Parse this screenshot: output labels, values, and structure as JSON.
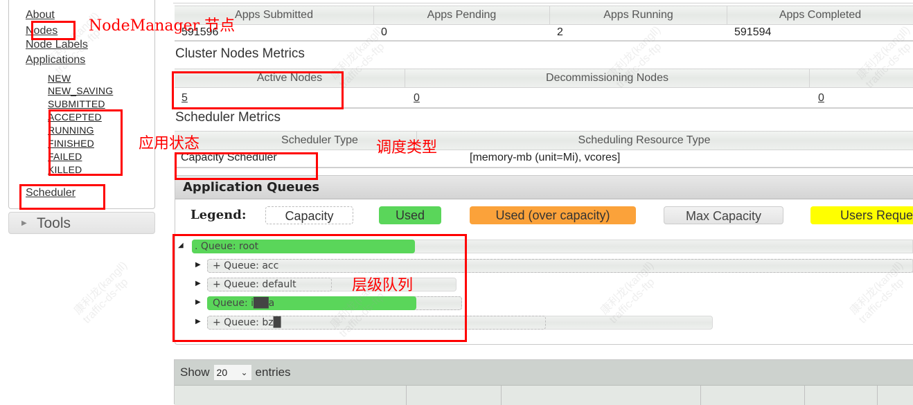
{
  "sidebar": {
    "links": {
      "about": "About",
      "nodes": "Nodes",
      "node_labels": "Node Labels",
      "applications": "Applications",
      "scheduler": "Scheduler"
    },
    "app_states": [
      "NEW",
      "NEW_SAVING",
      "SUBMITTED",
      "ACCEPTED",
      "RUNNING",
      "FINISHED",
      "FAILED",
      "KILLED"
    ],
    "tools_label": "Tools"
  },
  "cluster_metrics": {
    "headers": [
      "Apps Submitted",
      "Apps Pending",
      "Apps Running",
      "Apps Completed"
    ],
    "values": [
      "591596",
      "0",
      "2",
      "591594"
    ]
  },
  "cluster_nodes_metrics": {
    "title": "Cluster Nodes Metrics",
    "headers": [
      "Active Nodes",
      "Decommissioning Nodes",
      ""
    ],
    "values": [
      "5",
      "0",
      "0"
    ]
  },
  "scheduler_metrics": {
    "title": "Scheduler Metrics",
    "headers": [
      "Scheduler Type",
      "Scheduling Resource Type"
    ],
    "values": [
      "Capacity Scheduler",
      "[memory-mb (unit=Mi), vcores]"
    ]
  },
  "application_queues": {
    "title": "Application Queues",
    "legend_label": "Legend:",
    "legend": [
      {
        "label": "Capacity",
        "color": "#ffffff"
      },
      {
        "label": "Used",
        "color": "#5ad65a"
      },
      {
        "label": "Used (over capacity)",
        "color": "#fba23a"
      },
      {
        "label": "Max Capacity",
        "color": "#e8e8e8"
      },
      {
        "label": "Users Reques",
        "color": "#ffff00"
      }
    ],
    "queues": [
      {
        "label": ".   Queue: root",
        "expanded": true,
        "used_fraction": 0.31
      },
      {
        "label": "+ Queue: acc",
        "expanded": false,
        "used_fraction": 0.0
      },
      {
        "label": "+ Queue: default",
        "expanded": false,
        "used_fraction": 0.0
      },
      {
        "label": "   Queue: i██a",
        "expanded": false,
        "used_fraction": 0.82
      },
      {
        "label": "+ Queue: bz█",
        "expanded": false,
        "used_fraction": 0.0
      }
    ]
  },
  "datatable": {
    "show_label": "Show",
    "entries_value": "20",
    "entries_label": "entries"
  },
  "annotations": {
    "nodemanager": "NodeManager 节点",
    "app_state": "应用状态",
    "scheduler_type": "调度类型",
    "queue_hierarchy": "层级队列"
  },
  "watermark": {
    "line1": "康利龙(kangll)",
    "line2": "traffic-ds-ftp"
  },
  "colors": {
    "annotation_red": "#ff0000",
    "used_green": "#5ad65a",
    "over_orange": "#fba23a",
    "users_yellow": "#ffff00"
  }
}
